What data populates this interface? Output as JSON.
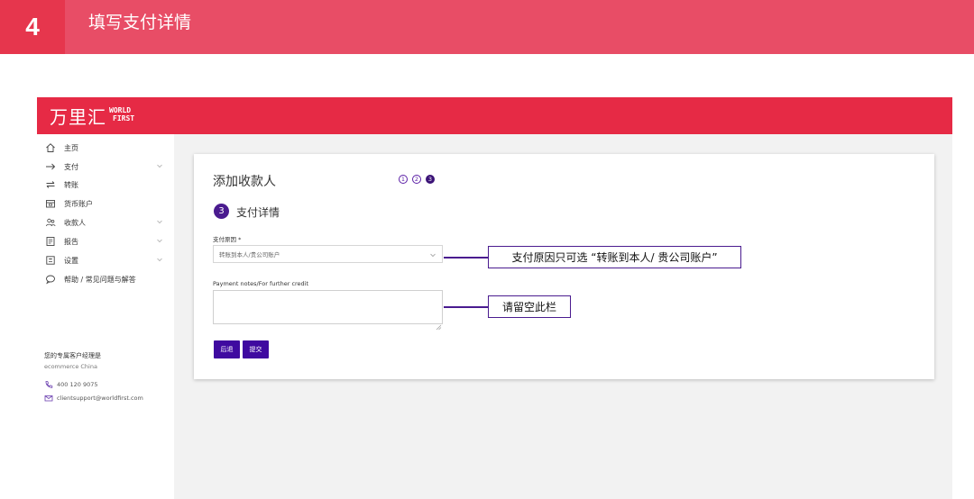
{
  "banner": {
    "number": "4",
    "title": "填写支付详情"
  },
  "logo": {
    "chinese": "万里汇",
    "english_line1": "WORLD",
    "english_line2": "FIRST"
  },
  "sidebar": {
    "items": [
      {
        "label": "主页",
        "icon": "home-icon",
        "expandable": false
      },
      {
        "label": "支付",
        "icon": "arrow-right-icon",
        "expandable": true
      },
      {
        "label": "转账",
        "icon": "transfer-icon",
        "expandable": false
      },
      {
        "label": "货币账户",
        "icon": "wallet-icon",
        "expandable": false
      },
      {
        "label": "收款人",
        "icon": "people-icon",
        "expandable": true
      },
      {
        "label": "报告",
        "icon": "report-icon",
        "expandable": true
      },
      {
        "label": "设置",
        "icon": "settings-icon",
        "expandable": true
      },
      {
        "label": "帮助 / 常见问题与解答",
        "icon": "help-chat-icon",
        "expandable": false
      }
    ],
    "manager_title": "您的专属客户经理是",
    "manager_name": "ecommerce China",
    "phone": "400 120 9075",
    "email": "clientsupport@worldfirst.com"
  },
  "card": {
    "title": "添加收款人",
    "steps": [
      "1",
      "2",
      "3"
    ],
    "active_step": 3,
    "step_number": "3",
    "step_title": "支付详情",
    "reason_label": "支付原因 *",
    "reason_value": "转账到本人/贵公司账户",
    "notes_label": "Payment notes/For further credit",
    "notes_value": "",
    "back_label": "后退",
    "submit_label": "提交"
  },
  "callouts": {
    "reason_note": "支付原因只可选 “转账到本人/ 贵公司账户”",
    "notes_note": "请留空此栏"
  },
  "colors": {
    "banner": "#e84d66",
    "header": "#e62a45",
    "primary_button": "#3f0aa0",
    "callout_border": "#4a1b8f"
  }
}
